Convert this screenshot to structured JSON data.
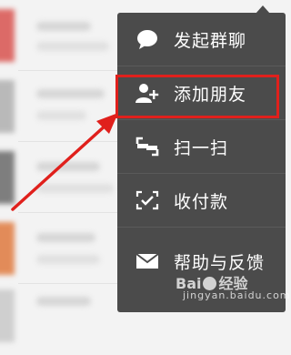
{
  "menu": {
    "items": [
      {
        "icon": "chat-bubble-icon",
        "label": "发起群聊"
      },
      {
        "icon": "add-friend-icon",
        "label": "添加朋友"
      },
      {
        "icon": "scan-icon",
        "label": "扫一扫"
      },
      {
        "icon": "receive-payment-icon",
        "label": "收付款"
      },
      {
        "icon": "mail-icon",
        "label": "帮助与反馈"
      }
    ]
  },
  "watermark": {
    "brand_prefix": "Bai",
    "brand_suffix": "经验",
    "url": "jingyan.baidu.com"
  },
  "colors": {
    "menu_background": "#4b4b4b",
    "highlight": "#e0201c",
    "text": "#ffffff"
  }
}
